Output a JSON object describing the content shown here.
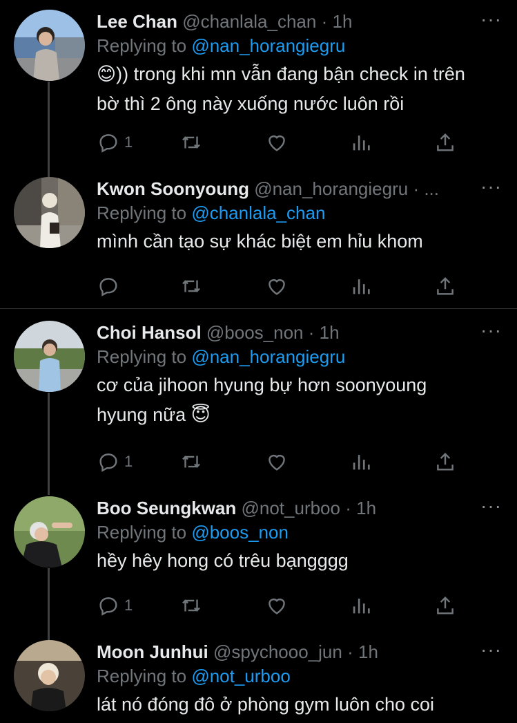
{
  "tweets": [
    {
      "name": "Lee Chan",
      "handle": "@chanlala_chan",
      "dot": "·",
      "time": "1h",
      "replying_prefix": "Replying to ",
      "replying_to": "@nan_horangiegru",
      "text_lines": [
        "😊)) trong khi mn vẫn đang bận check in trên",
        "bờ thì 2 ông này xuống nước luôn rồi"
      ],
      "reply_count": "1",
      "more": "···"
    },
    {
      "name": "Kwon Soonyoung",
      "handle": "@nan_horangiegru",
      "dot": "· ...",
      "time": "",
      "replying_prefix": "Replying to ",
      "replying_to": "@chanlala_chan",
      "text_lines": [
        "mình cần tạo sự khác biệt em hỉu khom"
      ],
      "reply_count": "",
      "more": "···"
    },
    {
      "name": "Choi Hansol",
      "handle": "@boos_non",
      "dot": "·",
      "time": "1h",
      "replying_prefix": "Replying to ",
      "replying_to": "@nan_horangiegru",
      "text_lines": [
        "cơ của jihoon hyung bự hơn soonyoung",
        "hyung nữa 😇"
      ],
      "reply_count": "1",
      "more": "···"
    },
    {
      "name": "Boo Seungkwan",
      "handle": "@not_urboo",
      "dot": "·",
      "time": "1h",
      "replying_prefix": "Replying to ",
      "replying_to": "@boos_non",
      "text_lines": [
        "hềy hêy hong có trêu bạngggg"
      ],
      "reply_count": "1",
      "more": "···"
    },
    {
      "name": "Moon Junhui",
      "handle": "@spychooo_jun",
      "dot": "·",
      "time": "1h",
      "replying_prefix": "Replying to ",
      "replying_to": "@not_urboo",
      "text_lines": [
        "lát nó đóng đô ở phòng gym luôn cho coi"
      ],
      "reply_count": "",
      "more": "···"
    }
  ],
  "icons": {
    "reply": "reply-icon",
    "retweet": "retweet-icon",
    "like": "heart-icon",
    "views": "views-icon",
    "share": "share-icon",
    "more": "more-icon"
  },
  "colors": {
    "background": "#000000",
    "text": "#e7e9ea",
    "secondary": "#71767b",
    "mention": "#1d9bf0",
    "divider": "#2f3336"
  }
}
